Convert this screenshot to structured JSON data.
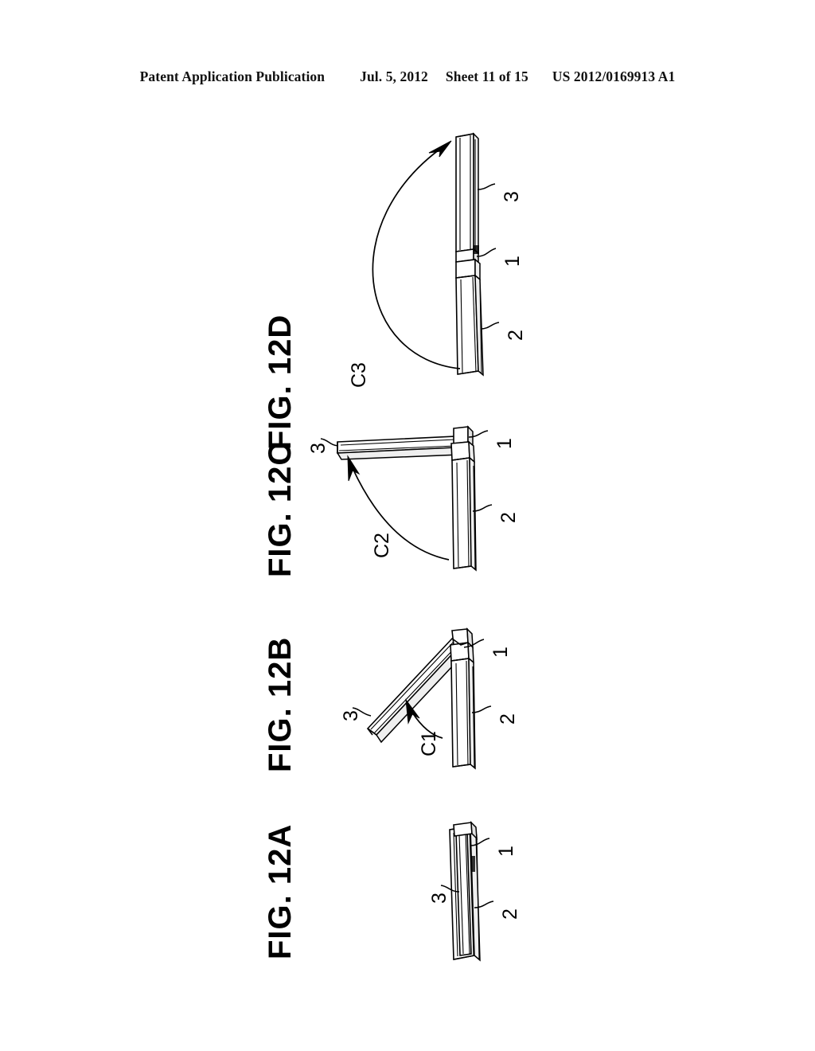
{
  "header": {
    "publication": "Patent Application Publication",
    "date": "Jul. 5, 2012",
    "sheet": "Sheet 11 of 15",
    "docnum": "US 2012/0169913 A1"
  },
  "figures": [
    {
      "id": "fig-12d",
      "label": "FIG. 12D",
      "state": "fully opened 360 degrees, panels back to back",
      "arc": {
        "label": "C3",
        "direction": "counterclockwise sweep, arrowhead at top"
      },
      "callouts": [
        {
          "ref": "3",
          "target": "display-panel-upper"
        },
        {
          "ref": "1",
          "target": "hinge"
        },
        {
          "ref": "2",
          "target": "body-panel-lower"
        }
      ]
    },
    {
      "id": "fig-12c",
      "label": "FIG. 12C",
      "state": "opened to approximately 90 degrees",
      "arc": {
        "label": "C2",
        "direction": "quarter sweep, arrowhead at upper left"
      },
      "callouts": [
        {
          "ref": "3",
          "target": "display-panel-upper"
        },
        {
          "ref": "1",
          "target": "hinge"
        },
        {
          "ref": "2",
          "target": "body-panel-lower"
        }
      ]
    },
    {
      "id": "fig-12b",
      "label": "FIG. 12B",
      "state": "partially opened, approximately 45 degrees",
      "arc": {
        "label": "C1",
        "direction": "short sweep, arrowhead at upper left"
      },
      "callouts": [
        {
          "ref": "3",
          "target": "display-panel-upper"
        },
        {
          "ref": "1",
          "target": "hinge"
        },
        {
          "ref": "2",
          "target": "body-panel-lower"
        }
      ]
    },
    {
      "id": "fig-12a",
      "label": "FIG. 12A",
      "state": "closed, panels stacked",
      "arc": null,
      "callouts": [
        {
          "ref": "1",
          "target": "hinge"
        },
        {
          "ref": "3",
          "target": "display-panel-upper"
        },
        {
          "ref": "2",
          "target": "body-panel-lower"
        }
      ]
    }
  ],
  "colors": {
    "ink": "#000000",
    "paper": "#ffffff",
    "shade_light": "#efefef",
    "shade_mid": "#e2e2e2"
  }
}
